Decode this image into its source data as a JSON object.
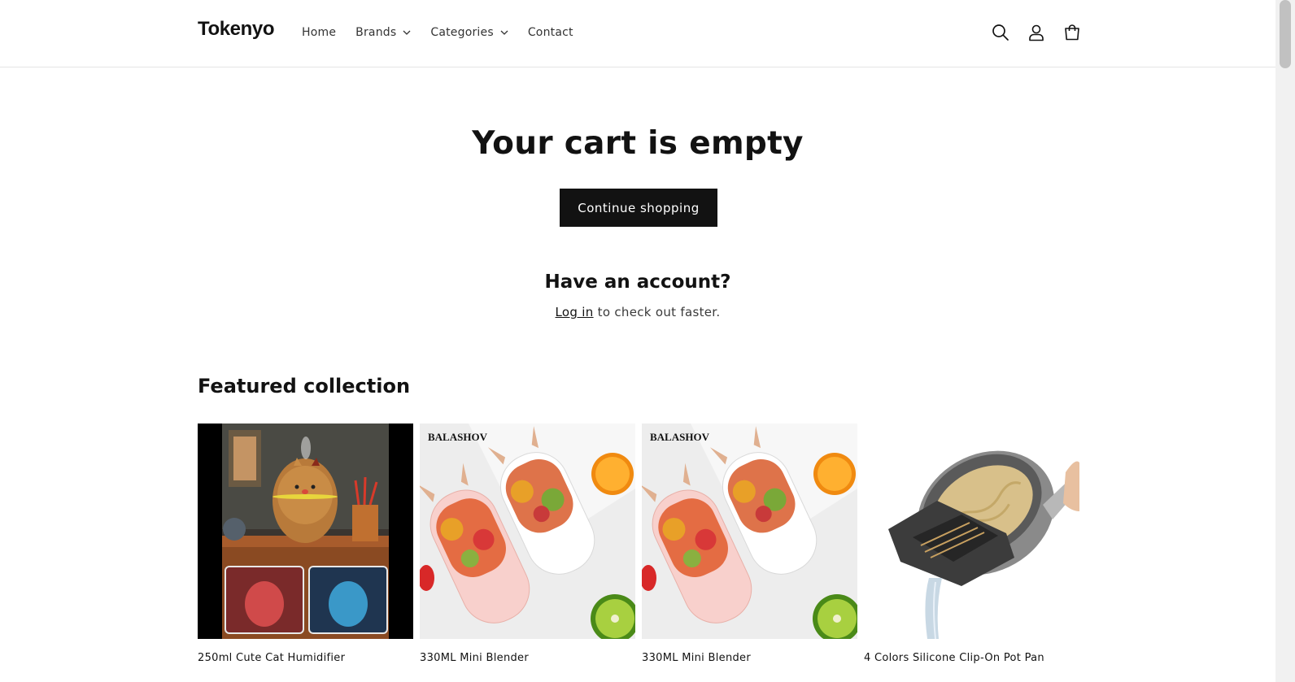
{
  "header": {
    "logo": "Tokenyo",
    "nav": [
      {
        "label": "Home",
        "dropdown": false
      },
      {
        "label": "Brands",
        "dropdown": true
      },
      {
        "label": "Categories",
        "dropdown": true
      },
      {
        "label": "Contact",
        "dropdown": false
      }
    ],
    "icons": [
      "search-icon",
      "account-icon",
      "cart-icon"
    ]
  },
  "cart": {
    "title": "Your cart is empty",
    "continue_label": "Continue shopping",
    "account_title": "Have an account?",
    "login_link": "Log in",
    "login_suffix": " to check out faster."
  },
  "featured": {
    "title": "Featured collection",
    "products": [
      {
        "title": "250ml Cute Cat Humidifier",
        "image": "cat-humidifier"
      },
      {
        "title": "330ML Mini Blender",
        "image": "bunny-blender",
        "brand": "BALASHOV"
      },
      {
        "title": "330ML Mini Blender",
        "image": "bunny-blender",
        "brand": "BALASHOV"
      },
      {
        "title": "4 Colors Silicone Clip-On Pot Pan",
        "image": "pot-strainer"
      }
    ]
  },
  "colors": {
    "primary": "#121212",
    "border": "#e5e5e5",
    "brand_accent": "#e05a1a"
  }
}
